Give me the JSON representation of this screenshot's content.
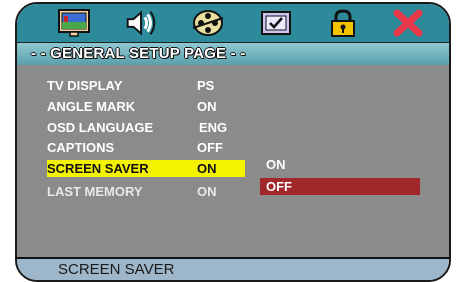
{
  "icons": [
    {
      "name": "tv-display-icon"
    },
    {
      "name": "speaker-audio-icon"
    },
    {
      "name": "film-reel-icon"
    },
    {
      "name": "checkbox-screen-icon"
    },
    {
      "name": "padlock-icon"
    },
    {
      "name": "close-x-icon"
    }
  ],
  "colors": {
    "icon_bar": "#2d8a9a",
    "menu_bg": "#8b8b8b",
    "selected_row": "#f5f200",
    "selected_option": "#a1272b",
    "status_bar": "#9eb6c9"
  },
  "title": "- - GENERAL SETUP PAGE - -",
  "menu": [
    {
      "label": "TV DISPLAY",
      "value": "PS"
    },
    {
      "label": "ANGLE MARK",
      "value": "ON"
    },
    {
      "label": "OSD LANGUAGE",
      "value": "ENG"
    },
    {
      "label": "CAPTIONS",
      "value": "OFF"
    },
    {
      "label": "SCREEN SAVER",
      "value": "ON",
      "selected": true
    },
    {
      "label": "LAST MEMORY",
      "value": "ON"
    }
  ],
  "options": [
    {
      "label": "ON"
    },
    {
      "label": "OFF",
      "selected": true
    }
  ],
  "status": "SCREEN SAVER"
}
